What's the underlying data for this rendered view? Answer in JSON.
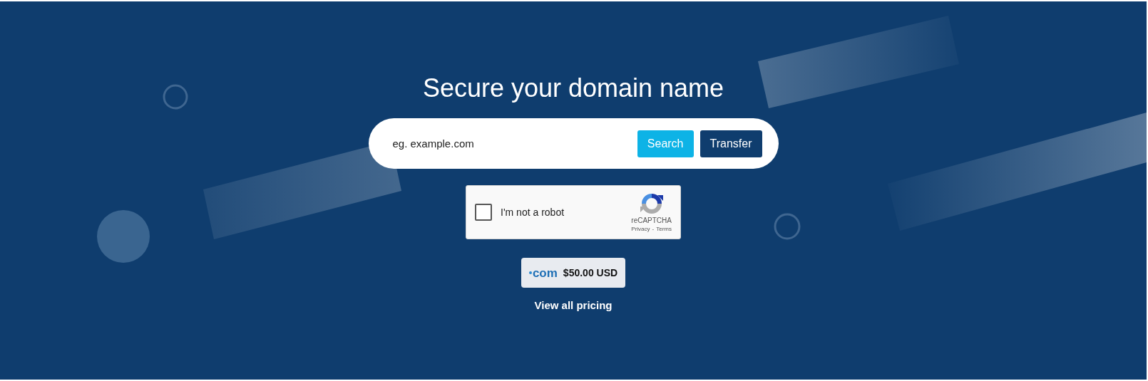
{
  "hero": {
    "title": "Secure your domain name"
  },
  "search": {
    "placeholder": "eg. example.com",
    "buttons": [
      {
        "label": "Search",
        "kind": "primary"
      },
      {
        "label": "Transfer",
        "kind": "secondary"
      }
    ]
  },
  "captcha": {
    "label": "I'm not a robot",
    "checked": false,
    "brand": "reCAPTCHA",
    "links": [
      "Privacy",
      "Terms"
    ],
    "separator": "-"
  },
  "price": {
    "tld_logo": "com",
    "amount": "$50.00 USD"
  },
  "pricing_link": "View all pricing"
}
